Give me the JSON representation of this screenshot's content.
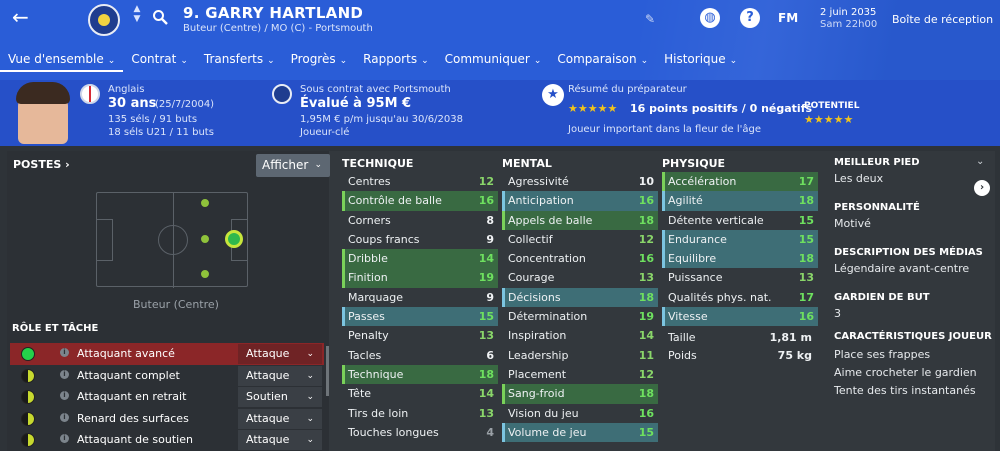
{
  "header": {
    "back_icon": "back-arrow-icon",
    "name": "9. GARRY HARTLAND",
    "position_club": "Buteur (Centre) / MO (C) - Portsmouth",
    "fm_label": "FM",
    "date_line1": "2 juin 2035",
    "date_line2": "Sam 22h00",
    "inbox_label": "Boîte de réception",
    "accent_color": "#2a5dd7"
  },
  "tabs": [
    {
      "label": "Vue d'ensemble"
    },
    {
      "label": "Contrat"
    },
    {
      "label": "Transferts"
    },
    {
      "label": "Progrès"
    },
    {
      "label": "Rapports"
    },
    {
      "label": "Communiquer"
    },
    {
      "label": "Comparaison"
    },
    {
      "label": "Historique"
    }
  ],
  "info": {
    "nationality": "Anglais",
    "age": "30 ans",
    "birth": "(25/7/2004)",
    "caps": "135 séls / 91 buts",
    "u21": "18 séls U21 / 11 buts",
    "contract_label": "Sous contrat avec Portsmouth",
    "value": "Évalué à 95M €",
    "wage": "1,95M € p/m jusqu'au 30/6/2038",
    "squad_status": "Joueur-clé",
    "coach_title": "Résumé du préparateur",
    "coach_summary": "16 points positifs / 0 négatifs",
    "coach_rating": 5,
    "potential_label": "POTENTIEL",
    "potential_rating": 5,
    "coach_note": "Joueur important dans la fleur de l'âge"
  },
  "positions": {
    "title": "POSTES",
    "afficher": "Afficher",
    "label": "Buteur (Centre)"
  },
  "roles_title": "RÔLE ET TÂCHE",
  "roles": [
    {
      "name": "Attaquant avancé",
      "duty": "Attaque"
    },
    {
      "name": "Attaquant complet",
      "duty": "Attaque"
    },
    {
      "name": "Attaquant en retrait",
      "duty": "Soutien"
    },
    {
      "name": "Renard des surfaces",
      "duty": "Attaque"
    },
    {
      "name": "Attaquant de soutien",
      "duty": "Attaque"
    }
  ],
  "technique": {
    "title": "TECHNIQUE",
    "items": [
      {
        "name": "Centres",
        "value": "12"
      },
      {
        "name": "Contrôle de balle",
        "value": "16"
      },
      {
        "name": "Corners",
        "value": "8"
      },
      {
        "name": "Coups francs",
        "value": "9"
      },
      {
        "name": "Dribble",
        "value": "14"
      },
      {
        "name": "Finition",
        "value": "19"
      },
      {
        "name": "Marquage",
        "value": "9"
      },
      {
        "name": "Passes",
        "value": "15"
      },
      {
        "name": "Penalty",
        "value": "13"
      },
      {
        "name": "Tacles",
        "value": "6"
      },
      {
        "name": "Technique",
        "value": "18"
      },
      {
        "name": "Tête",
        "value": "14"
      },
      {
        "name": "Tirs de loin",
        "value": "13"
      },
      {
        "name": "Touches longues",
        "value": "4"
      }
    ]
  },
  "mental": {
    "title": "MENTAL",
    "items": [
      {
        "name": "Agressivité",
        "value": "10"
      },
      {
        "name": "Anticipation",
        "value": "16"
      },
      {
        "name": "Appels de balle",
        "value": "18"
      },
      {
        "name": "Collectif",
        "value": "12"
      },
      {
        "name": "Concentration",
        "value": "16"
      },
      {
        "name": "Courage",
        "value": "13"
      },
      {
        "name": "Décisions",
        "value": "18"
      },
      {
        "name": "Détermination",
        "value": "19"
      },
      {
        "name": "Inspiration",
        "value": "14"
      },
      {
        "name": "Leadership",
        "value": "11"
      },
      {
        "name": "Placement",
        "value": "12"
      },
      {
        "name": "Sang-froid",
        "value": "18"
      },
      {
        "name": "Vision du jeu",
        "value": "16"
      },
      {
        "name": "Volume de jeu",
        "value": "15"
      }
    ]
  },
  "physique": {
    "title": "PHYSIQUE",
    "items": [
      {
        "name": "Accélération",
        "value": "17"
      },
      {
        "name": "Agilité",
        "value": "18"
      },
      {
        "name": "Détente verticale",
        "value": "15"
      },
      {
        "name": "Endurance",
        "value": "15"
      },
      {
        "name": "Equilibre",
        "value": "18"
      },
      {
        "name": "Puissance",
        "value": "13"
      },
      {
        "name": "Qualités phys. nat.",
        "value": "17"
      },
      {
        "name": "Vitesse",
        "value": "16"
      }
    ],
    "height_label": "Taille",
    "height": "1,81 m",
    "weight_label": "Poids",
    "weight": "75 kg"
  },
  "right": {
    "foot_title": "MEILLEUR PIED",
    "foot": "Les deux",
    "personality_title": "PERSONNALITÉ",
    "personality": "Motivé",
    "media_title": "DESCRIPTION DES MÉDIAS",
    "media": "Légendaire avant-centre",
    "gk_title": "GARDIEN DE BUT",
    "gk": "3",
    "traits_title": "CARACTÉRISTIQUES JOUEUR",
    "traits": [
      "Place ses frappes",
      "Aime crocheter le gardien",
      "Tente des tirs instantanés"
    ]
  }
}
